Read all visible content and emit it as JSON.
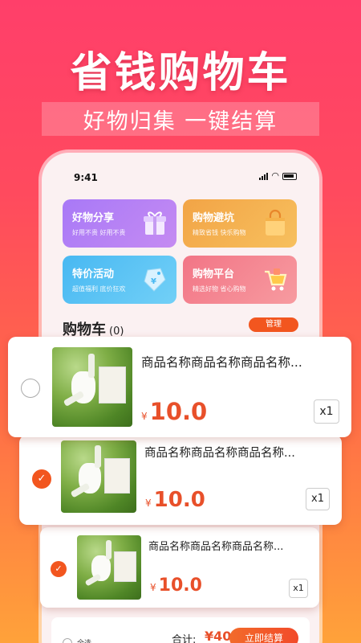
{
  "promo": {
    "headline": "省钱购物车",
    "subheadline": "好物归集 一键结算"
  },
  "status_bar": {
    "time": "9:41"
  },
  "categories": [
    {
      "title": "好物分享",
      "subtitle": "好用不贵 好用不贵",
      "icon": "gift-box-icon",
      "color": "#a879f7"
    },
    {
      "title": "购物避坑",
      "subtitle": "精致省钱 快乐购物",
      "icon": "shopping-bag-icon",
      "color": "#f2a446"
    },
    {
      "title": "特价活动",
      "subtitle": "超值福利 底价狂欢",
      "icon": "discount-tag-icon",
      "color": "#48b8f2"
    },
    {
      "title": "购物平台",
      "subtitle": "精选好物 省心购物",
      "icon": "shopping-cart-icon",
      "color": "#f27586"
    }
  ],
  "cart": {
    "title": "购物车",
    "count": "(0)",
    "manage_label": "管理",
    "items": [
      {
        "name": "商品名称商品名称商品名称...",
        "currency": "¥",
        "price": "10.0",
        "quantity": "x1",
        "selected": false
      },
      {
        "name": "商品名称商品名称商品名称...",
        "currency": "¥",
        "price": "10.0",
        "quantity": "x1",
        "selected": true
      },
      {
        "name": "商品名称商品名称商品名称...",
        "currency": "¥",
        "price": "10.0",
        "quantity": "x1",
        "selected": true
      }
    ]
  },
  "footer": {
    "select_all_label": "全选",
    "total_label": "合计:",
    "total_value": "¥40",
    "checkout_label": "立即结算"
  },
  "colors": {
    "accent": "#f2561f",
    "price": "#e8502a"
  }
}
